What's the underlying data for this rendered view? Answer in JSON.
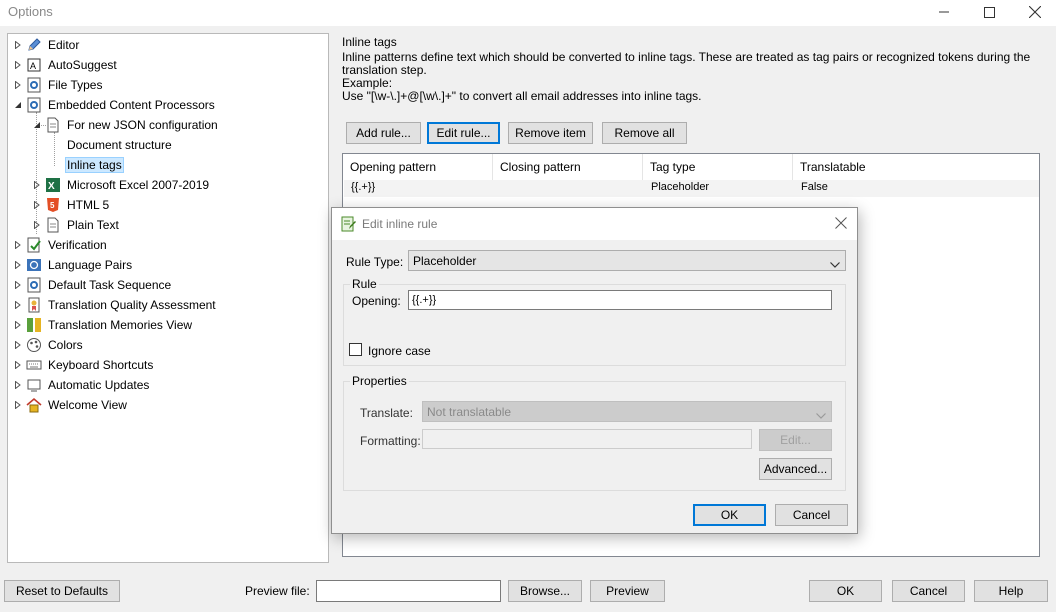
{
  "window": {
    "title": "Options"
  },
  "tree": {
    "items": [
      {
        "label": "Editor"
      },
      {
        "label": "AutoSuggest"
      },
      {
        "label": "File Types"
      },
      {
        "label": "Embedded Content Processors"
      },
      {
        "label": "For new JSON configuration"
      },
      {
        "label": "Document structure"
      },
      {
        "label": "Inline tags"
      },
      {
        "label": "Microsoft Excel 2007-2019"
      },
      {
        "label": "HTML 5"
      },
      {
        "label": "Plain Text"
      },
      {
        "label": "Verification"
      },
      {
        "label": "Language Pairs"
      },
      {
        "label": "Default Task Sequence"
      },
      {
        "label": "Translation Quality Assessment"
      },
      {
        "label": "Translation Memories View"
      },
      {
        "label": "Colors"
      },
      {
        "label": "Keyboard Shortcuts"
      },
      {
        "label": "Automatic Updates"
      },
      {
        "label": "Welcome View"
      }
    ]
  },
  "panel": {
    "section_title": "Inline tags",
    "description": [
      "Inline patterns define text which should be converted to inline tags. These are treated as tag pairs or recognized tokens during the",
      "translation step.",
      "Example:",
      "Use \"[\\w-\\.]+@[\\w\\.]+\" to convert all email addresses into inline tags."
    ],
    "buttons": {
      "add": "Add rule...",
      "edit": "Edit rule...",
      "remove": "Remove item",
      "remove_all": "Remove all"
    },
    "grid": {
      "columns": [
        "Opening pattern",
        "Closing pattern",
        "Tag type",
        "Translatable"
      ],
      "rows": [
        {
          "opening": "{{.+}}",
          "closing": "",
          "tag_type": "Placeholder",
          "translatable": "False"
        }
      ]
    }
  },
  "bottom": {
    "reset": "Reset to Defaults",
    "preview_label": "Preview file:",
    "preview_value": "",
    "browse": "Browse...",
    "preview": "Preview",
    "ok": "OK",
    "cancel": "Cancel",
    "help": "Help"
  },
  "dialog": {
    "title": "Edit inline rule",
    "rule_type_label": "Rule Type:",
    "rule_type_value": "Placeholder",
    "rule_group": "Rule",
    "opening_label": "Opening:",
    "opening_value": "{{.+}}",
    "ignore_case_label": "Ignore case",
    "ignore_case_checked": false,
    "properties_group": "Properties",
    "translate_label": "Translate:",
    "translate_value": "Not translatable",
    "formatting_label": "Formatting:",
    "formatting_value": "",
    "edit_button": "Edit...",
    "advanced_button": "Advanced...",
    "ok": "OK",
    "cancel": "Cancel"
  },
  "colors": {
    "selection": "#cce8ff",
    "focus_border": "#0078d7",
    "button_face": "#e1e1e1"
  }
}
